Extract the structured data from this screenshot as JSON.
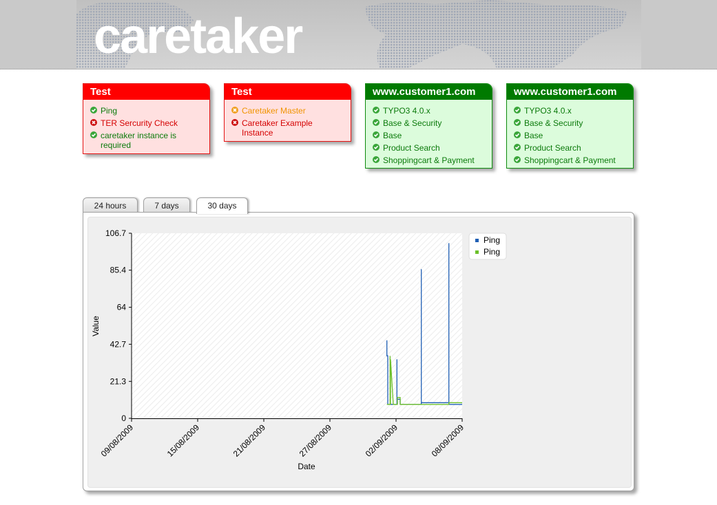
{
  "header": {
    "logo": "caretaker"
  },
  "boxes": [
    {
      "title": "Test",
      "color": "#ff0000",
      "items": [
        {
          "label": "Ping",
          "status": "ok"
        },
        {
          "label": "TER Sercurity Check",
          "status": "error"
        },
        {
          "label": "caretaker instance is required",
          "status": "ok"
        }
      ]
    },
    {
      "title": "Test",
      "color": "#ff0000",
      "items": [
        {
          "label": "Caretaker Master",
          "status": "warning"
        },
        {
          "label": "Caretaker Example Instance",
          "status": "error"
        }
      ]
    },
    {
      "title": "www.customer1.com",
      "color": "#007a00",
      "items": [
        {
          "label": "TYPO3 4.0.x",
          "status": "ok"
        },
        {
          "label": "Base & Security",
          "status": "ok"
        },
        {
          "label": "Base",
          "status": "ok"
        },
        {
          "label": "Product Search",
          "status": "ok"
        },
        {
          "label": "Shoppingcart & Payment",
          "status": "ok"
        }
      ]
    },
    {
      "title": "www.customer1.com",
      "color": "#007a00",
      "items": [
        {
          "label": "TYPO3 4.0.x",
          "status": "ok"
        },
        {
          "label": "Base & Security",
          "status": "ok"
        },
        {
          "label": "Base",
          "status": "ok"
        },
        {
          "label": "Product Search",
          "status": "ok"
        },
        {
          "label": "Shoppingcart & Payment",
          "status": "ok"
        }
      ]
    }
  ],
  "tabs": [
    {
      "label": "24 hours",
      "active": false
    },
    {
      "label": "7 days",
      "active": false
    },
    {
      "label": "30 days",
      "active": true
    }
  ],
  "colors": {
    "series1": "#1f5fb4",
    "series2": "#6cc02a"
  },
  "chart_data": {
    "type": "line",
    "xlabel": "Date",
    "ylabel": "Value",
    "ylim": [
      0,
      106.7
    ],
    "y_ticks": [
      "0",
      "21.3",
      "42.7",
      "64",
      "85.4",
      "106.7"
    ],
    "x_ticks": [
      "09/08/2009",
      "15/08/2009",
      "21/08/2009",
      "27/08/2009",
      "02/09/2009",
      "08/09/2009"
    ],
    "xlim": [
      "2009-08-09",
      "2009-09-08"
    ],
    "legend": "right",
    "series": [
      {
        "name": "Ping",
        "color": "#1f5fb4",
        "x": [
          "2009-09-01T04:00",
          "2009-09-01T04:00",
          "2009-09-01T06:00",
          "2009-09-01T06:00",
          "2009-09-01T09:00",
          "2009-09-01T14:00",
          "2009-09-01T23:00",
          "2009-09-02T02:00",
          "2009-09-02T02:00",
          "2009-09-02T02:00",
          "2009-09-02T09:00",
          "2009-09-02T09:00",
          "2009-09-03T09:00",
          "2009-09-04T07:00",
          "2009-09-04T07:00",
          "2009-09-04T07:00",
          "2009-09-06T19:00",
          "2009-09-06T19:00",
          "2009-09-06T19:00",
          "2009-09-08T00:00"
        ],
        "y": [
          45,
          36,
          36,
          8,
          8,
          8,
          8,
          8,
          34,
          11,
          11,
          8,
          8,
          8,
          86,
          9,
          9,
          101,
          8,
          8
        ]
      },
      {
        "name": "Ping",
        "color": "#6cc02a",
        "x": [
          "2009-09-01T04:00",
          "2009-09-01T11:00",
          "2009-09-01T11:00",
          "2009-09-01T12:00",
          "2009-09-01T12:00",
          "2009-09-01T18:00",
          "2009-09-02T03:00",
          "2009-09-02T03:00",
          "2009-09-02T09:00",
          "2009-09-02T09:00",
          "2009-09-04T07:00",
          "2009-09-04T07:00",
          "2009-09-06T19:00",
          "2009-09-06T19:00",
          "2009-09-08T00:00"
        ],
        "y": [
          8,
          8,
          36,
          8,
          34,
          8,
          8,
          12,
          12,
          8,
          8,
          8,
          8,
          9,
          9
        ]
      }
    ]
  }
}
